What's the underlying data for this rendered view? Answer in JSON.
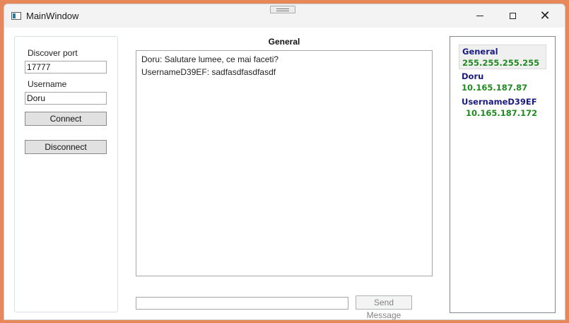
{
  "window": {
    "title": "MainWindow"
  },
  "left": {
    "port_label": "Discover port",
    "port_value": "17777",
    "username_label": "Username",
    "username_value": "Doru",
    "connect_label": "Connect",
    "disconnect_label": "Disconnect"
  },
  "chat": {
    "title": "General",
    "messages": [
      "Doru: Salutare lumee, ce mai faceti?",
      "UsernameD39EF: sadfasdfasdfasdf"
    ],
    "input_value": "",
    "send_label": "Send Message"
  },
  "peers": [
    {
      "name": "General",
      "ip": "255.255.255.255",
      "selected": true
    },
    {
      "name": "Doru",
      "ip": "10.165.187.87",
      "selected": false
    },
    {
      "name": "UsernameD39EF",
      "ip": "10.165.187.172",
      "selected": false
    }
  ],
  "colors": {
    "peer_name": "#1a1a80",
    "peer_ip": "#1f8a1f",
    "desktop": "#e8875a"
  }
}
